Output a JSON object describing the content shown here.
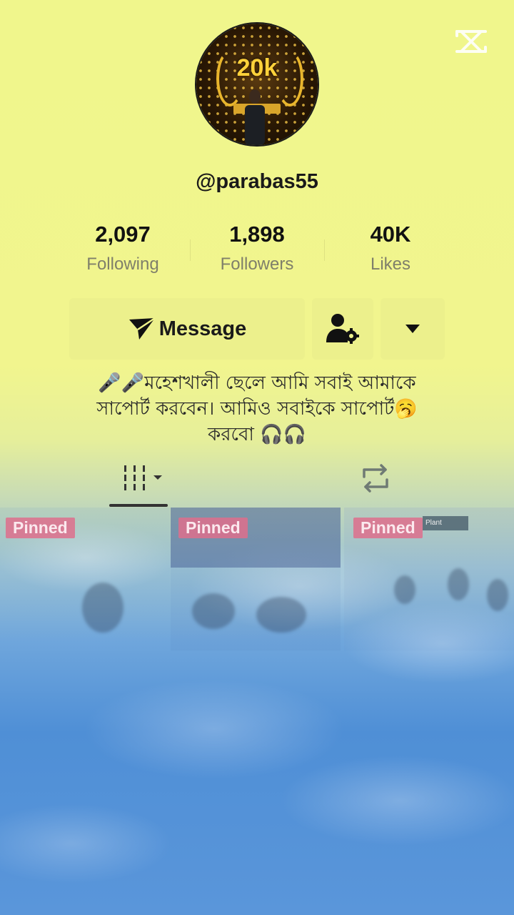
{
  "profile": {
    "username": "@parabas55",
    "avatar_badge": "20k"
  },
  "stats": [
    {
      "value": "2,097",
      "label": "Following"
    },
    {
      "value": "1,898",
      "label": "Followers"
    },
    {
      "value": "40K",
      "label": "Likes"
    }
  ],
  "actions": {
    "message_label": "Message"
  },
  "bio": {
    "line1": "🎤🎤মহেশখালী ছেলে আমি সবাই আমাকে",
    "line2": "সাপোর্ট করবেন। আমিও সবাইকে সাপোর্ট🥱",
    "line3": "করবো 🎧🎧"
  },
  "videos": [
    {
      "badge": "Pinned"
    },
    {
      "badge": "Pinned"
    },
    {
      "badge": "Pinned",
      "sign_text": "Plant"
    }
  ],
  "icons": {
    "top_right": "capcut-logo-icon",
    "message": "send-arrow-icon",
    "user_settings": "user-gear-icon",
    "more": "caret-down-icon",
    "videos_tab": "grid-bars-icon",
    "reposts_tab": "repost-icon"
  }
}
